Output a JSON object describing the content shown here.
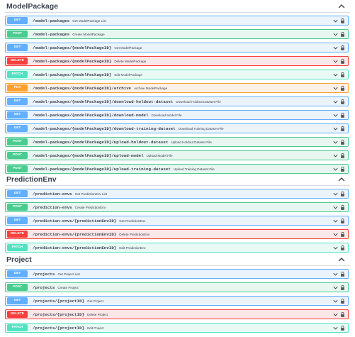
{
  "sections": [
    {
      "title": "ModelPackage",
      "operations": [
        {
          "method": "GET",
          "path": "/model-packages",
          "summary": "Get ModelPackage List"
        },
        {
          "method": "POST",
          "path": "/model-packages",
          "summary": "Create ModelPackage"
        },
        {
          "method": "GET",
          "path": "/model-packages/{modelPackageID}",
          "summary": "Get ModelPackage"
        },
        {
          "method": "DELETE",
          "path": "/model-packages/{modelPackageID}",
          "summary": "Delete ModelPackage"
        },
        {
          "method": "PATCH",
          "path": "/model-packages/{modelPackageID}",
          "summary": "Edit ModelPackage"
        },
        {
          "method": "PUT",
          "path": "/model-packages/{modelPackageID}/archive",
          "summary": "Archive ModelPackage"
        },
        {
          "method": "GET",
          "path": "/model-packages/{modelPackageID}/download-holdout-dataset",
          "summary": "Download Holdout Dataset File"
        },
        {
          "method": "GET",
          "path": "/model-packages/{modelPackageID}/download-model",
          "summary": "Download Model File"
        },
        {
          "method": "GET",
          "path": "/model-packages/{modelPackageID}/download-training-dataset",
          "summary": "Download Training Dataset File"
        },
        {
          "method": "POST",
          "path": "/model-packages/{modelPackageID}/upload-holdout-dataset",
          "summary": "Upload Holdout Dataset File"
        },
        {
          "method": "POST",
          "path": "/model-packages/{modelPackageID}/upload-model",
          "summary": "Upload Model File"
        },
        {
          "method": "POST",
          "path": "/model-packages/{modelPackageID}/upload-training-dataset",
          "summary": "Upload Training Dataset File"
        }
      ]
    },
    {
      "title": "PredictionEnv",
      "operations": [
        {
          "method": "GET",
          "path": "/prediction-envs",
          "summary": "Get PredictionEnv List"
        },
        {
          "method": "POST",
          "path": "/prediction-envs",
          "summary": "Create PredictionEnv"
        },
        {
          "method": "GET",
          "path": "/prediction-envs/{predictionEnvID}",
          "summary": "Get PredictionEnv"
        },
        {
          "method": "DELETE",
          "path": "/prediction-envs/{predictionEnvID}",
          "summary": "Delete PredictionEnv"
        },
        {
          "method": "PATCH",
          "path": "/prediction-envs/{predictionEnvID}",
          "summary": "Edit PredictionEnv"
        }
      ]
    },
    {
      "title": "Project",
      "operations": [
        {
          "method": "GET",
          "path": "/projects",
          "summary": "Get Project List"
        },
        {
          "method": "POST",
          "path": "/projects",
          "summary": "Create Project"
        },
        {
          "method": "GET",
          "path": "/projects/{projectID}",
          "summary": "Get Project"
        },
        {
          "method": "DELETE",
          "path": "/projects/{projectID}",
          "summary": "Delete Project"
        },
        {
          "method": "PATCH",
          "path": "/projects/{projectID}",
          "summary": "Edit Project"
        }
      ]
    }
  ],
  "colors": {
    "get": "#61affe",
    "post": "#49cc90",
    "delete": "#f93e3e",
    "patch": "#50e3c2",
    "put": "#fca130",
    "text": "#3b4151"
  },
  "icons": {
    "section_toggle": "chevron-up-icon",
    "operation_toggle": "chevron-down-icon",
    "auth": "lock-icon"
  }
}
